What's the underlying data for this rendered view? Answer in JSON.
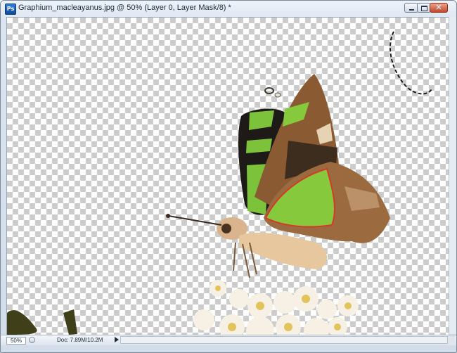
{
  "window": {
    "title": "Graphium_macleayanus.jpg @ 50% (Layer 0, Layer Mask/8) *",
    "app_icon_label": "Ps",
    "close_glyph": "✕"
  },
  "status_bar": {
    "zoom": "50%",
    "doc_info": "Doc: 7.89M/10.2M"
  },
  "canvas": {
    "subject": "butterfly on white flowers (transparent background)",
    "colors": {
      "wing_brown": "#8a5a32",
      "wing_green": "#86c93c",
      "wing_black": "#1d1a17",
      "body_tan": "#d9b48c",
      "flower_white": "#f6f1e4",
      "flower_yellow": "#e2c35c",
      "leaf_dark": "#3f3f1a"
    }
  },
  "icons": [
    "ps-app-icon",
    "minimize-icon",
    "maximize-icon",
    "close-icon",
    "navigator-icon",
    "play-icon"
  ]
}
